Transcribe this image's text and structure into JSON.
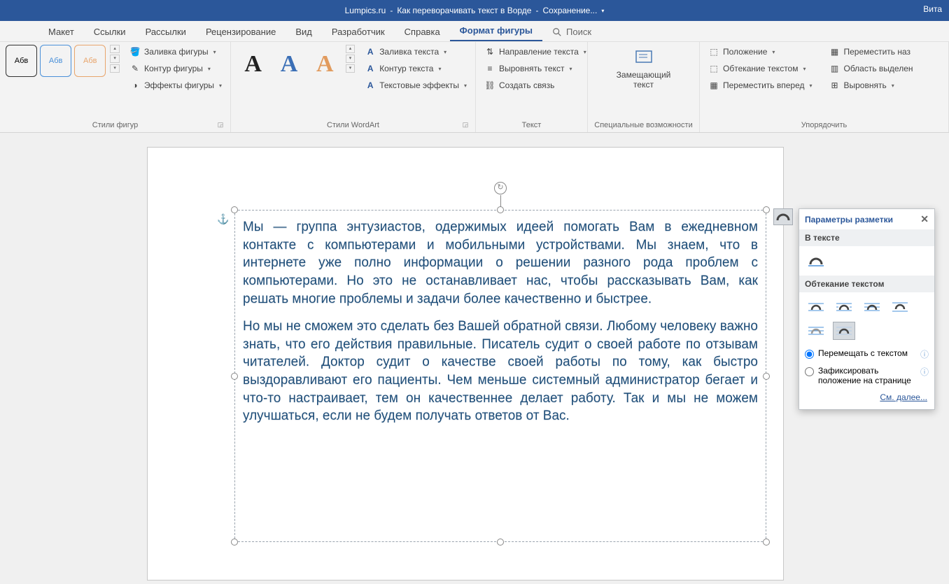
{
  "titlebar": {
    "site": "Lumpics.ru",
    "doc": "Как переворачивать текст в Ворде",
    "status": "Сохранение...",
    "user": "Вита"
  },
  "tabs": {
    "items": [
      "Макет",
      "Ссылки",
      "Рассылки",
      "Рецензирование",
      "Вид",
      "Разработчик",
      "Справка",
      "Формат фигуры"
    ],
    "active": "Формат фигуры",
    "search": "Поиск"
  },
  "ribbon": {
    "shape_styles": {
      "label": "Стили фигур",
      "thumb": "Абв",
      "fill": "Заливка фигуры",
      "outline": "Контур фигуры",
      "effects": "Эффекты фигуры"
    },
    "wordart": {
      "label": "Стили WordArt",
      "fill": "Заливка текста",
      "outline": "Контур текста",
      "effects": "Текстовые эффекты"
    },
    "text": {
      "label": "Текст",
      "direction": "Направление текста",
      "align": "Выровнять текст",
      "link": "Создать связь"
    },
    "access": {
      "label": "Специальные возможности",
      "alt": "Замещающий текст"
    },
    "arrange": {
      "label": "Упорядочить",
      "position": "Положение",
      "wrap": "Обтекание текстом",
      "forward": "Переместить вперед",
      "send_back": "Переместить наз",
      "selection": "Область выделен",
      "align": "Выровнять"
    }
  },
  "document": {
    "p1": "Мы — группа энтузиастов, одержимых идеей помогать Вам в ежедневном контакте с компьютерами и мобильными устройствами. Мы знаем, что в интернете уже полно информации о решении разного рода проблем с компьютерами. Но это не останавливает нас, чтобы рассказывать Вам, как решать многие проблемы и задачи более качественно и быстрее.",
    "p2": "Но мы не сможем это сделать без Вашей обратной связи. Любому человеку важно знать, что его действия правильные. Писатель судит о своей работе по отзывам читателей. Доктор судит о качестве своей работы по тому, как быстро выздоравливают его пациенты. Чем меньше системный администратор бегает и что-то настраивает, тем он качественнее делает работу. Так и мы не можем улучшаться, если не будем получать ответов от Вас."
  },
  "popup": {
    "title": "Параметры разметки",
    "sec_inline": "В тексте",
    "sec_wrap": "Обтекание текстом",
    "opt_move": "Перемещать с текстом",
    "opt_fix": "Зафиксировать положение на странице",
    "more": "См. далее..."
  }
}
